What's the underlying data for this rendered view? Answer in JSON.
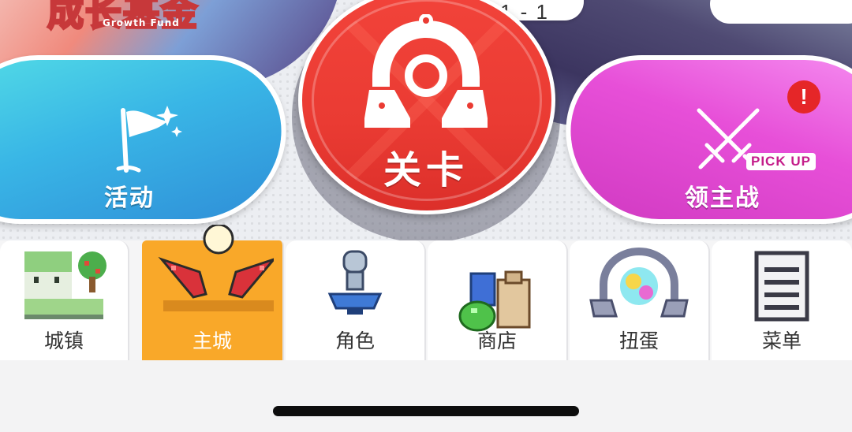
{
  "banner": {
    "fund_title": "成长基金",
    "fund_subtitle": "Growth Fund",
    "stage_progress": "1 - 1"
  },
  "actions": {
    "events_label": "活动",
    "stage_label": "关卡",
    "boss_label": "领主战",
    "pickup_badge": "PICK UP",
    "alert_mark": "!"
  },
  "tabs": [
    {
      "label": "城镇",
      "icon": "town-icon",
      "active": false
    },
    {
      "label": "主城",
      "icon": "main-city-icon",
      "active": true
    },
    {
      "label": "角色",
      "icon": "character-icon",
      "active": false
    },
    {
      "label": "商店",
      "icon": "shop-icon",
      "active": false
    },
    {
      "label": "扭蛋",
      "icon": "gacha-icon",
      "active": false
    },
    {
      "label": "菜单",
      "icon": "menu-icon",
      "active": false
    }
  ],
  "colors": {
    "events_pill": "#39b6e6",
    "stage_button": "#ea3b33",
    "boss_pill": "#e74fd8",
    "active_tab": "#f9a829",
    "alert": "#e52628"
  }
}
